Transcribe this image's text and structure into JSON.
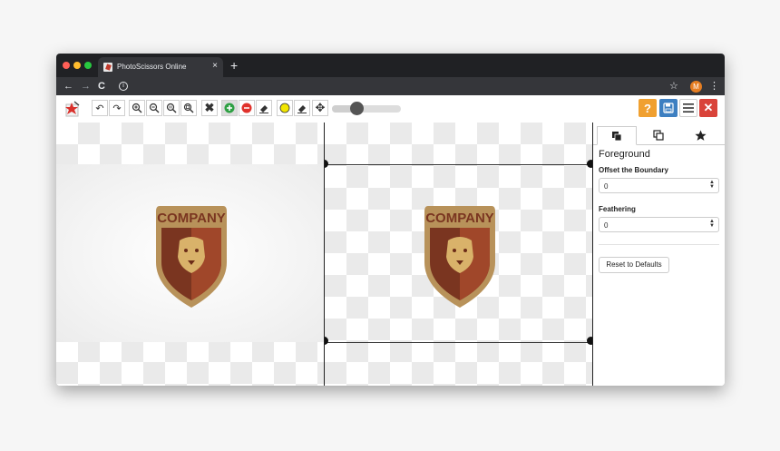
{
  "browser": {
    "tab_title": "PhotoScissors Online",
    "tab_close": "×",
    "new_tab": "+",
    "nav_back": "←",
    "nav_forward": "→",
    "nav_reload": "C",
    "info": "i",
    "star": "☆",
    "profile_initial": "M",
    "menu": "⋮",
    "traffic_lights": {
      "close": "#ff5f57",
      "minimize": "#febc2e",
      "maximize": "#28c840"
    }
  },
  "toolbar": {
    "undo_icon": "↶",
    "redo_icon": "↷",
    "clear_icon": "✖",
    "move_icon": "✥",
    "help_label": "?",
    "close_label": "✕",
    "brush_size_fraction": 0.33,
    "colors": {
      "foreground_marker": "#2ea043",
      "background_marker": "#e0322c",
      "hair_marker": "#f2e600",
      "help": "#f0a030",
      "save": "#3d7fc1",
      "close": "#d9433a"
    }
  },
  "emblem": {
    "text": "COMPANY",
    "colors": {
      "shield_dark": "#7a3520",
      "shield_light": "#a0472a",
      "gold": "#b8925a",
      "face": "#d9b26a"
    }
  },
  "sidebar": {
    "section_title": "Foreground",
    "offset_label": "Offset the Boundary",
    "offset_value": "0",
    "feathering_label": "Feathering",
    "feathering_value": "0",
    "reset_label": "Reset to Defaults",
    "spin_up": "▲",
    "spin_down": "▼"
  }
}
